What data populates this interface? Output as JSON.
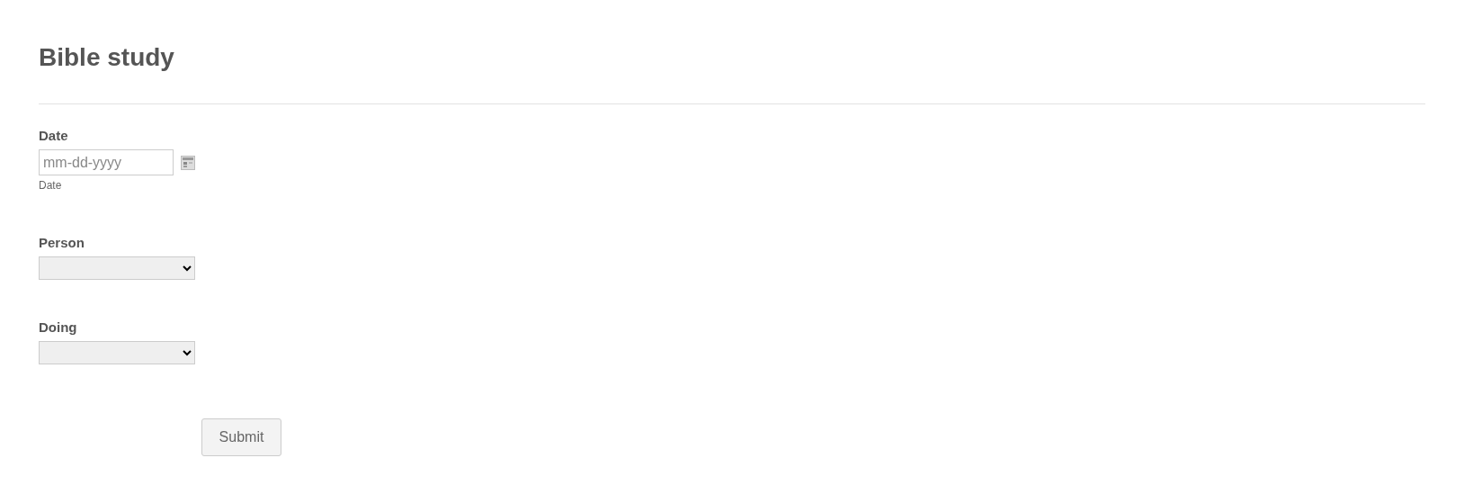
{
  "title": "Bible study",
  "fields": [
    {
      "kind": "date",
      "label": "Date",
      "placeholder": "mm-dd-yyyy",
      "sublabel": "Date"
    },
    {
      "kind": "select",
      "label": "Person"
    },
    {
      "kind": "select",
      "label": "Doing"
    }
  ],
  "submit": "Submit"
}
